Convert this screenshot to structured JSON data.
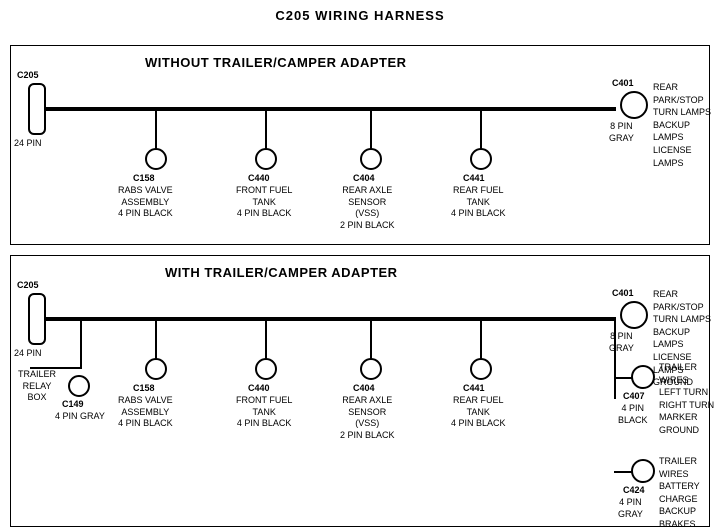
{
  "title": "C205 WIRING HARNESS",
  "section1": {
    "label": "WITHOUT  TRAILER/CAMPER ADAPTER",
    "left_connector": {
      "id": "C205",
      "pins": "24 PIN"
    },
    "right_connector": {
      "id": "C401",
      "pins": "8 PIN",
      "color": "GRAY",
      "label": "REAR PARK/STOP\nTURN LAMPS\nBACKUP LAMPS\nLICENSE LAMPS"
    },
    "connectors": [
      {
        "id": "C158",
        "desc": "RABS VALVE\nASSEMBLY\n4 PIN BLACK"
      },
      {
        "id": "C440",
        "desc": "FRONT FUEL\nTANK\n4 PIN BLACK"
      },
      {
        "id": "C404",
        "desc": "REAR AXLE\nSENSOR\n(VSS)\n2 PIN BLACK"
      },
      {
        "id": "C441",
        "desc": "REAR FUEL\nTANK\n4 PIN BLACK"
      }
    ]
  },
  "section2": {
    "label": "WITH TRAILER/CAMPER ADAPTER",
    "left_connector": {
      "id": "C205",
      "pins": "24 PIN"
    },
    "right_connector": {
      "id": "C401",
      "pins": "8 PIN",
      "color": "GRAY",
      "label": "REAR PARK/STOP\nTURN LAMPS\nBACKUP LAMPS\nLICENSE LAMPS\nGROUND"
    },
    "trailer_relay": {
      "label": "TRAILER\nRELAY\nBOX"
    },
    "c149": {
      "id": "C149",
      "desc": "4 PIN GRAY"
    },
    "connectors": [
      {
        "id": "C158",
        "desc": "RABS VALVE\nASSEMBLY\n4 PIN BLACK"
      },
      {
        "id": "C440",
        "desc": "FRONT FUEL\nTANK\n4 PIN BLACK"
      },
      {
        "id": "C404",
        "desc": "REAR AXLE\nSENSOR\n(VSS)\n2 PIN BLACK"
      },
      {
        "id": "C441",
        "desc": "REAR FUEL\nTANK\n4 PIN BLACK"
      }
    ],
    "right_connectors": [
      {
        "id": "C407",
        "pins": "4 PIN",
        "color": "BLACK",
        "label": "TRAILER WIRES\nLEFT TURN\nRIGHT TURN\nMARKER\nGROUND"
      },
      {
        "id": "C424",
        "pins": "4 PIN",
        "color": "GRAY",
        "label": "TRAILER WIRES\nBATTERY CHARGE\nBACKUP\nBRAKES"
      }
    ]
  }
}
